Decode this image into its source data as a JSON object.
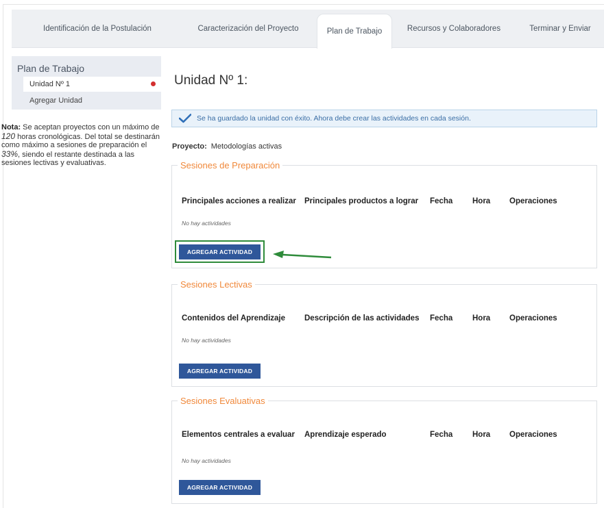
{
  "tabs": [
    {
      "label": "Identificación de la Postulación",
      "active": false
    },
    {
      "label": "Caracterización del Proyecto",
      "active": false
    },
    {
      "label": "Plan de Trabajo",
      "active": true
    },
    {
      "label": "Recursos y Colaboradores",
      "active": false
    },
    {
      "label": "Terminar y Enviar",
      "active": false
    }
  ],
  "sidebar": {
    "title": "Plan de Trabajo",
    "items": [
      {
        "label": "Unidad Nº 1"
      },
      {
        "label": "Agregar Unidad"
      }
    ],
    "status_color": "#d32f2f"
  },
  "note": {
    "bold": "Nota:",
    "text1": " Se aceptan proyectos con un máximo de ",
    "hours": "120",
    "text2": " horas cronológicas. Del total se destinarán como máximo a sesiones de preparación el ",
    "percent": "33%",
    "text3": ", siendo el restante destinada a las sesiones lectivas y evaluativas."
  },
  "main": {
    "unit_title": "Unidad Nº 1:",
    "alert": "Se ha guardado la unidad con éxito. Ahora debe crear las actividades en cada sesión.",
    "proyecto_label": "Proyecto:",
    "proyecto_value": "Metodologías activas"
  },
  "sections": [
    {
      "legend": "Sesiones de Preparación",
      "columns": [
        "Principales acciones a realizar",
        "Principales productos a lograr",
        "Fecha",
        "Hora",
        "Operaciones"
      ],
      "empty": "No hay actividades",
      "button": "AGREGAR ACTIVIDAD"
    },
    {
      "legend": "Sesiones Lectivas",
      "columns": [
        "Contenidos del Aprendizaje",
        "Descripción de las actividades",
        "Fecha",
        "Hora",
        "Operaciones"
      ],
      "empty": "No hay actividades",
      "button": "AGREGAR ACTIVIDAD"
    },
    {
      "legend": "Sesiones Evaluativas",
      "columns": [
        "Elementos centrales a evaluar",
        "Aprendizaje esperado",
        "Fecha",
        "Hora",
        "Operaciones"
      ],
      "empty": "No hay actividades",
      "button": "AGREGAR ACTIVIDAD"
    }
  ],
  "colors": {
    "accent": "#2f579a",
    "legend": "#f0883a",
    "highlight": "#2e8b3a",
    "alert_text": "#3a6ea5"
  },
  "icons": [
    "check-icon",
    "arrow-left-icon"
  ]
}
